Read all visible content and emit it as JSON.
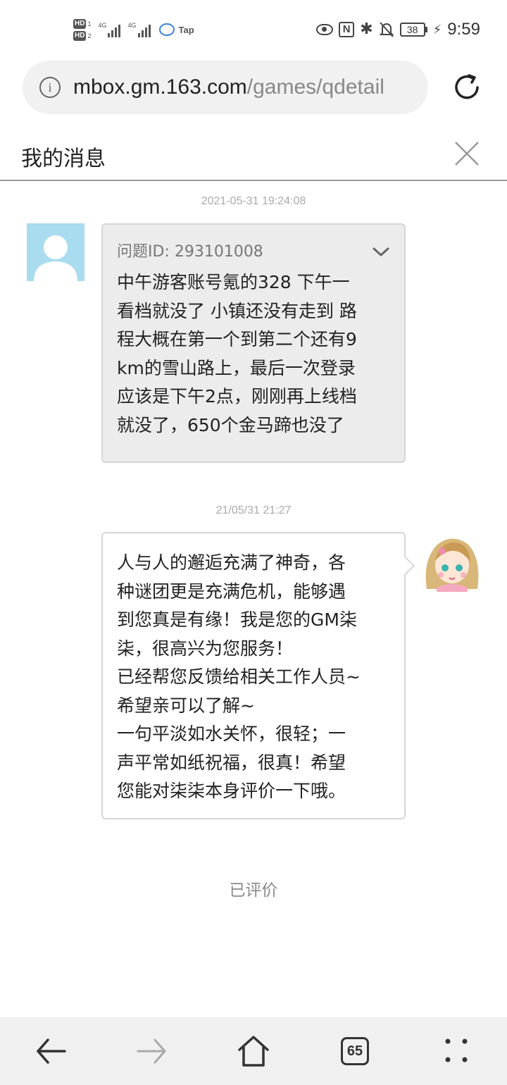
{
  "status_bar": {
    "sim1": "HD",
    "sim1_num": "1",
    "sim2": "HD",
    "sim2_num": "2",
    "network1": "4G",
    "network2": "4G",
    "app_label": "Tap",
    "battery": "38",
    "time": "9:59",
    "icons": [
      "eye-icon",
      "nfc-icon",
      "bluetooth-icon",
      "bell-off-icon",
      "battery-icon",
      "charging-icon"
    ]
  },
  "browser": {
    "url_host": "mbox.gm.163.com",
    "url_path": "/games/qdetail",
    "tab_count": "65"
  },
  "page": {
    "title": "我的消息"
  },
  "messages": [
    {
      "timestamp": "2021-05-31 19:24:08",
      "question_id": "问题ID: 293101008",
      "lines": [
        "中午游客账号氪的328 下午一",
        "看档就没了 小镇还没有走到 路",
        "程大概在第一个到第二个还有9",
        "km的雪山路上，最后一次登录",
        "应该是下午2点，刚刚再上线档",
        "就没了，650个金马蹄也没了"
      ]
    },
    {
      "timestamp": "21/05/31 21:27",
      "lines": [
        "人与人的邂逅充满了神奇，各",
        "种谜团更是充满危机，能够遇",
        "到您真是有缘！我是您的GM柒",
        "柒，很高兴为您服务！",
        "已经帮您反馈给相关工作人员~",
        "希望亲可以了解~",
        "一句平淡如水关怀，很轻；一",
        "声平常如纸祝福，很真！希望",
        "您能对柒柒本身评价一下哦。"
      ]
    }
  ],
  "rating_status": "已评价",
  "colors": {
    "user_avatar_bg": "#a9dcef",
    "user_bubble_bg": "#ececec",
    "bottom_bar_bg": "#f0f0f0"
  }
}
